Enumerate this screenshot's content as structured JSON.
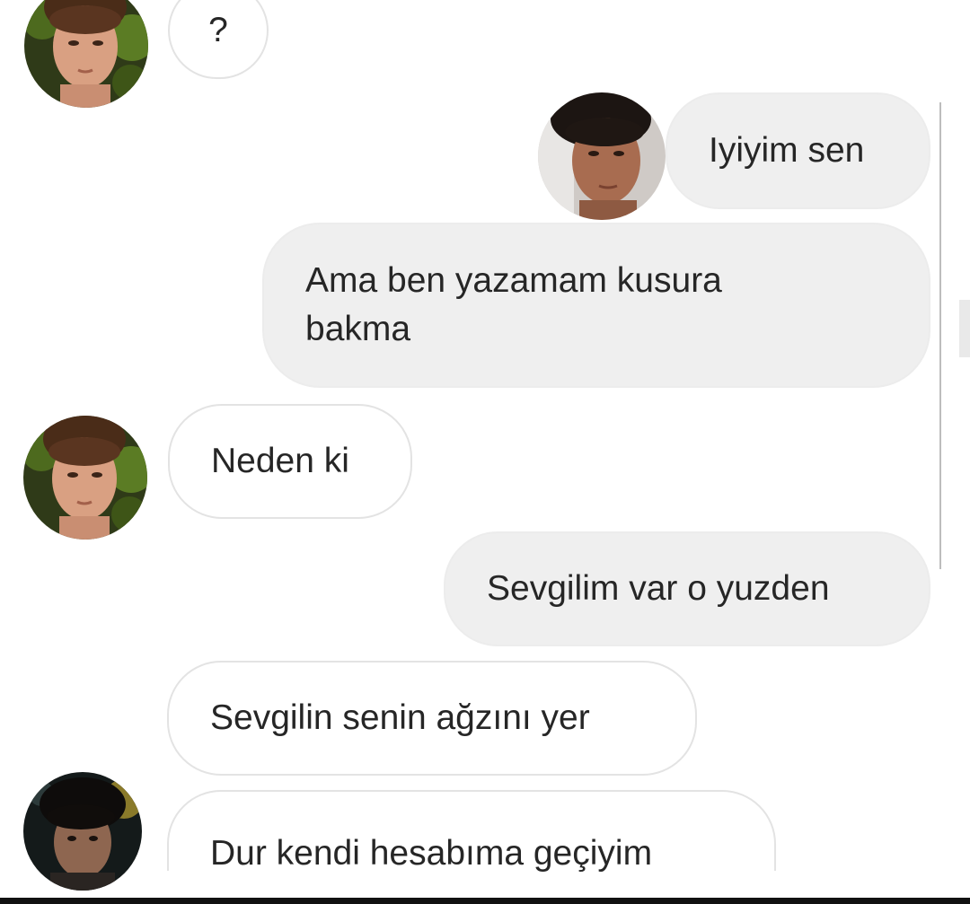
{
  "messages": [
    {
      "side": "in",
      "text": "?"
    },
    {
      "side": "out",
      "text": "Iyiyim sen"
    },
    {
      "side": "out",
      "text": "Ama ben yazamam kusura bakma"
    },
    {
      "side": "in",
      "text": "Neden ki"
    },
    {
      "side": "out",
      "text": "Sevgilim var o yuzden"
    },
    {
      "side": "in",
      "text": "Sevgilin senin ağzını yer"
    },
    {
      "side": "in",
      "text": "Dur kendi hesabıma geçiyim"
    }
  ],
  "colors": {
    "incoming_bubble_bg": "#ffffff",
    "incoming_bubble_border": "#e3e3e3",
    "outgoing_bubble_bg": "#efefef",
    "text": "#262626",
    "background": "#ffffff"
  },
  "icons": {
    "avatar_contact": "avatar-contact-photo",
    "avatar_self": "avatar-self-photo",
    "avatar_alt_account": "avatar-alt-account-photo"
  }
}
